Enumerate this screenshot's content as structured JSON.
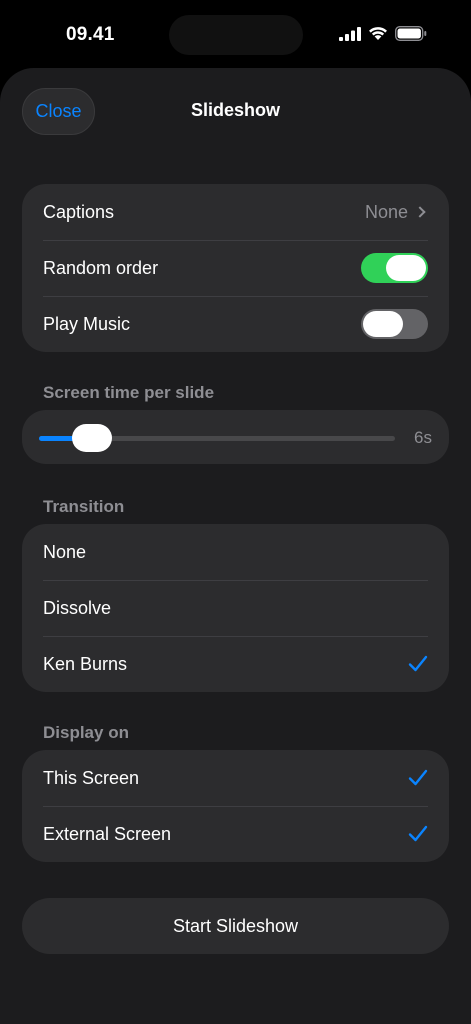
{
  "status": {
    "time": "09.41"
  },
  "sheet": {
    "close_label": "Close",
    "title": "Slideshow"
  },
  "options": {
    "captions_label": "Captions",
    "captions_value": "None",
    "random_order_label": "Random order",
    "random_order_on": true,
    "play_music_label": "Play Music",
    "play_music_on": false
  },
  "screen_time": {
    "label": "Screen time per slide",
    "value": "6s",
    "level": 0.15
  },
  "transition": {
    "label": "Transition",
    "items": [
      {
        "label": "None",
        "selected": false
      },
      {
        "label": "Dissolve",
        "selected": false
      },
      {
        "label": "Ken Burns",
        "selected": true
      }
    ]
  },
  "display_on": {
    "label": "Display on",
    "items": [
      {
        "label": "This Screen",
        "selected": true
      },
      {
        "label": "External Screen",
        "selected": true
      }
    ]
  },
  "start_label": "Start Slideshow",
  "colors": {
    "accent": "#0a84ff",
    "toggle_on": "#30d158",
    "toggle_off": "#636366",
    "sheet_bg": "#1c1c1e",
    "cell_bg": "#2c2c2e"
  }
}
